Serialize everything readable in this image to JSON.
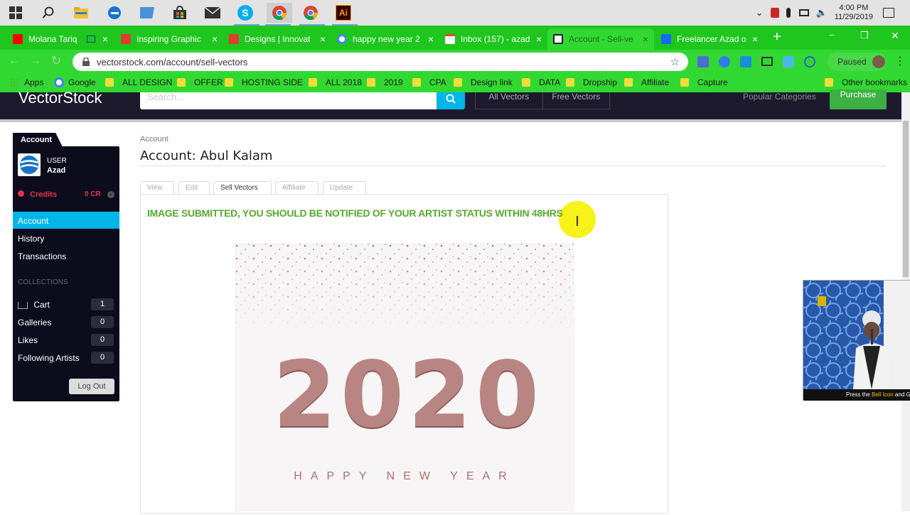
{
  "taskbar": {
    "icons": [
      "windows-icon",
      "search-icon",
      "file-explorer-icon",
      "edge-icon",
      "terminal-icon",
      "store-icon",
      "mail-icon",
      "skype-icon",
      "chrome-icon",
      "chrome-icon-2",
      "illustrator-icon"
    ],
    "skype_label": "S",
    "illustrator_label": "Ai",
    "time": "4:00 PM",
    "date": "11/29/2019"
  },
  "tabs": [
    {
      "title": "Molana Tariq",
      "favicon_color": "#ff0000"
    },
    {
      "title": "Inspiring Graphic",
      "favicon_color": "#e03c31"
    },
    {
      "title": "Designs | Innovat",
      "favicon_color": "#e03c31"
    },
    {
      "title": "happy new year 2",
      "favicon_color": "#4285f4"
    },
    {
      "title": "Inbox (157) - azad",
      "favicon_color": "#ea4335"
    },
    {
      "title": "Account - Sell-ve",
      "favicon_color": "#1a1a2e"
    },
    {
      "title": "Freelancer Azad o",
      "favicon_color": "#1769ff"
    }
  ],
  "tab_close": "×",
  "new_tab": "+",
  "window_controls": {
    "minimize": "−",
    "restore": "❐",
    "close": "✕"
  },
  "address": {
    "url": "vectorstock.com/account/sell-vectors",
    "paused": "Paused"
  },
  "bookmarks": {
    "apps": "Apps",
    "google": "Google",
    "folders": [
      "ALL DESIGN",
      "OFFER",
      "HOSTING SIDE",
      "ALL 2018",
      "2019",
      "CPA",
      "Design link",
      "DATA",
      "Dropship",
      "Affiliate",
      "Capture"
    ],
    "other": "Other bookmarks"
  },
  "site": {
    "logo": "VectorStock",
    "search_placeholder": "Search...",
    "nav": [
      "All Vectors",
      "Free Vectors"
    ],
    "popular": "Popular Categories",
    "purchase": "Purchase"
  },
  "sidebar": {
    "tab": "Account",
    "user_label": "USER",
    "username": "Azad",
    "credits_label": "Credits",
    "credits_value": "0 CR",
    "menu": [
      "Account",
      "History",
      "Transactions"
    ],
    "collections_title": "COLLECTIONS",
    "collections": [
      {
        "label": "Cart",
        "count": "1"
      },
      {
        "label": "Galleries",
        "count": "0"
      },
      {
        "label": "Likes",
        "count": "0"
      },
      {
        "label": "Following Artists",
        "count": "0"
      }
    ],
    "logout": "Log Out"
  },
  "main": {
    "breadcrumb": "Account",
    "title": "Account: Abul Kalam",
    "tabs": [
      "View",
      "Edit",
      "Sell Vectors",
      "Affiliate",
      "Update"
    ],
    "active_tab": "Sell Vectors",
    "message": "IMAGE SUBMITTED, YOU SHOULD BE NOTIFIED OF YOUR ARTIST STATUS WITHIN 48HRS",
    "artwork": {
      "year": "2020",
      "caption": "HAPPY NEW YEAR"
    }
  },
  "video_overlay": {
    "caption_start": "Press the ",
    "caption_hl": "Bell Icon",
    "caption_end": " and Ge"
  },
  "colors": {
    "chrome_green": "#1ec61e",
    "accent": "#00b5e8",
    "message_green": "#5aa832",
    "purchase_green": "#3cb043",
    "credits_red": "#e8334a",
    "rose_gold": "#b0706c"
  }
}
